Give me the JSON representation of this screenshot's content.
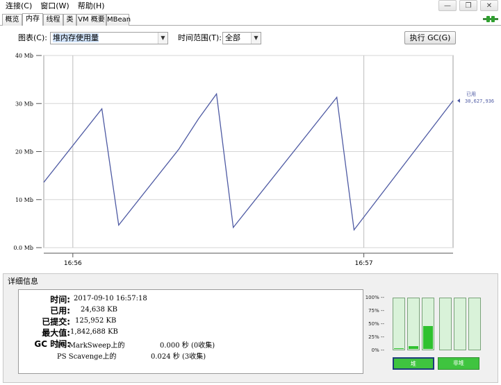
{
  "menu": [
    "连接(C)",
    "窗口(W)",
    "帮助(H)"
  ],
  "window_controls": [
    "—",
    "❐",
    "✕"
  ],
  "tabs": [
    {
      "label": "概览",
      "active": false
    },
    {
      "label": "内存",
      "active": true
    },
    {
      "label": "线程",
      "active": false
    },
    {
      "label": "类",
      "active": false
    },
    {
      "label": "VM 概要",
      "active": false
    },
    {
      "label": "MBean",
      "active": false
    }
  ],
  "controls": {
    "chart_label": "图表(C):",
    "chart_value": "堆内存使用量",
    "time_label": "时间范围(T):",
    "time_value": "全部",
    "gc_button": "执行 GC(G)"
  },
  "chart_data": {
    "type": "line",
    "y_ticks": [
      "0.0 Mb",
      "10 Mb",
      "20 Mb",
      "30 Mb",
      "40 Mb"
    ],
    "ylim": [
      0,
      40
    ],
    "x_ticks": [
      "16:56",
      "16:57"
    ],
    "series": [
      {
        "name": "已用",
        "points": [
          [
            0.0,
            13.6
          ],
          [
            0.142,
            28.9
          ],
          [
            0.183,
            4.7
          ],
          [
            0.33,
            20.5
          ],
          [
            0.378,
            26.8
          ],
          [
            0.422,
            32.0
          ],
          [
            0.463,
            4.2
          ],
          [
            0.716,
            31.3
          ],
          [
            0.758,
            3.7
          ],
          [
            1.0,
            30.6
          ]
        ]
      }
    ],
    "marker": {
      "label": "已用",
      "value": "30,627,936"
    },
    "colors": {
      "line": "#4e5aa3",
      "grid": "#d5d5d5",
      "vgrid": "#bdbdbd"
    }
  },
  "details": {
    "title": "详细信息",
    "rows": [
      {
        "label": "时间:",
        "value": "2017-09-10 16:57:18"
      },
      {
        "label": "已用:",
        "value": "24,638 KB"
      },
      {
        "label": "已提交:",
        "value": "125,952 KB"
      },
      {
        "label": "最大值:",
        "value": "1,842,688 KB"
      }
    ],
    "gc_label": "GC 时间:",
    "gc": [
      {
        "name": "PS MarkSweep上的",
        "value": "0.000 秒 (0收集)"
      },
      {
        "name": "PS Scavenge上的",
        "value": "0.024 秒 (3收集)"
      }
    ]
  },
  "pools": {
    "percent_labels": [
      "100% --",
      "75% --",
      "50% --",
      "25% --",
      "0% --"
    ],
    "bars": [
      0.02,
      0.05,
      0.45,
      0.0,
      0.0,
      0.0
    ],
    "buttons": [
      "堆",
      "非堆"
    ],
    "colors": {
      "fill": "#2fc12f",
      "empty": "#d9f2d9"
    }
  }
}
